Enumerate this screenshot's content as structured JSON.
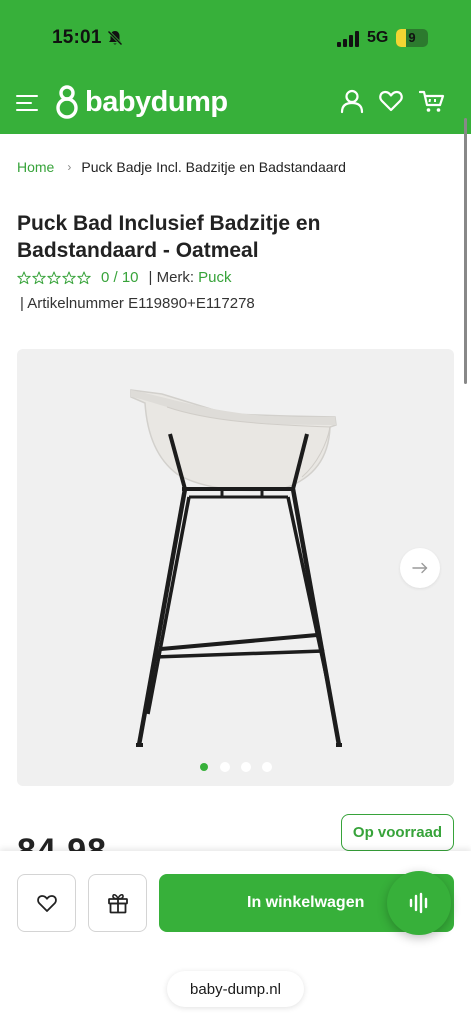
{
  "status_bar": {
    "time": "15:01",
    "network": "5G",
    "battery_level": "9",
    "battery_fraction": 0.3
  },
  "header": {
    "logo_text": "babydump",
    "icons": [
      "menu-icon",
      "account-icon",
      "heart-icon",
      "cart-icon"
    ]
  },
  "breadcrumb": {
    "home": "Home",
    "current": "Puck Badje Incl. Badzitje en Badstandaard"
  },
  "product": {
    "title": "Puck Bad Inclusief Badzitje en Badstandaard - Oatmeal",
    "rating": "0 / 10",
    "stars_filled": 0,
    "stars_total": 5,
    "brand_label": "| Merk:",
    "brand": "Puck",
    "sku_label": "| Artikelnummer",
    "sku": "E119890+E117278",
    "price": "84,98",
    "stock": "Op voorraad"
  },
  "gallery": {
    "image_count": 4,
    "active_index": 0
  },
  "actions": {
    "add_to_cart": "In winkelwagen"
  },
  "browser": {
    "url": "baby-dump.nl"
  },
  "colors": {
    "brand_green": "#37b03a",
    "link_green": "#37a33a"
  }
}
